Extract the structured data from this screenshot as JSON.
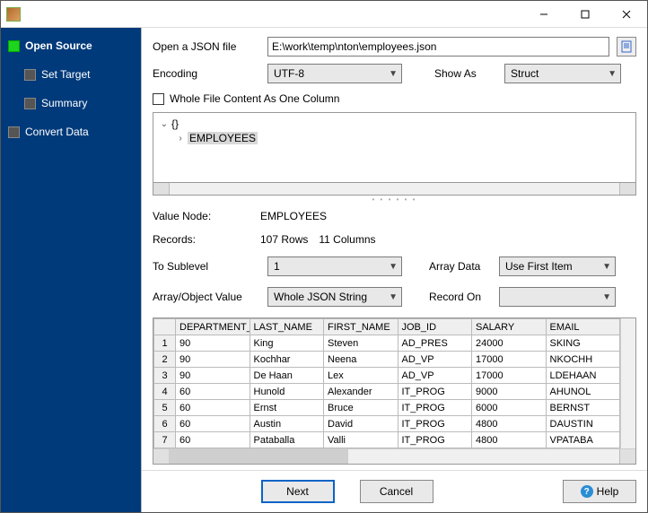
{
  "window": {
    "title": ""
  },
  "sidebar": {
    "items": [
      {
        "label": "Open Source",
        "active": true
      },
      {
        "label": "Set Target",
        "active": false
      },
      {
        "label": "Summary",
        "active": false
      },
      {
        "label": "Convert Data",
        "active": false
      }
    ]
  },
  "form": {
    "open_json_label": "Open a JSON file",
    "path": "E:\\work\\temp\\nton\\employees.json",
    "encoding_label": "Encoding",
    "encoding_value": "UTF-8",
    "showas_label": "Show As",
    "showas_value": "Struct",
    "whole_file_label": "Whole File Content As One Column",
    "tree_root": "{}",
    "tree_node": "EMPLOYEES",
    "value_node_label": "Value Node:",
    "value_node": "EMPLOYEES",
    "records_label": "Records:",
    "records_rows": "107 Rows",
    "records_cols": "11 Columns",
    "to_sublevel_label": "To Sublevel",
    "to_sublevel_value": "1",
    "array_data_label": "Array Data",
    "array_data_value": "Use First Item",
    "array_obj_label": "Array/Object Value",
    "array_obj_value": "Whole JSON String",
    "record_on_label": "Record On",
    "record_on_value": ""
  },
  "table": {
    "columns": [
      "DEPARTMENT_ID",
      "LAST_NAME",
      "FIRST_NAME",
      "JOB_ID",
      "SALARY",
      "EMAIL"
    ],
    "rows": [
      [
        "90",
        "King",
        "Steven",
        "AD_PRES",
        "24000",
        "SKING"
      ],
      [
        "90",
        "Kochhar",
        "Neena",
        "AD_VP",
        "17000",
        "NKOCHH"
      ],
      [
        "90",
        "De Haan",
        "Lex",
        "AD_VP",
        "17000",
        "LDEHAAN"
      ],
      [
        "60",
        "Hunold",
        "Alexander",
        "IT_PROG",
        "9000",
        "AHUNOL"
      ],
      [
        "60",
        "Ernst",
        "Bruce",
        "IT_PROG",
        "6000",
        "BERNST"
      ],
      [
        "60",
        "Austin",
        "David",
        "IT_PROG",
        "4800",
        "DAUSTIN"
      ],
      [
        "60",
        "Pataballa",
        "Valli",
        "IT_PROG",
        "4800",
        "VPATABA"
      ]
    ]
  },
  "footer": {
    "next": "Next",
    "cancel": "Cancel",
    "help": "Help"
  }
}
